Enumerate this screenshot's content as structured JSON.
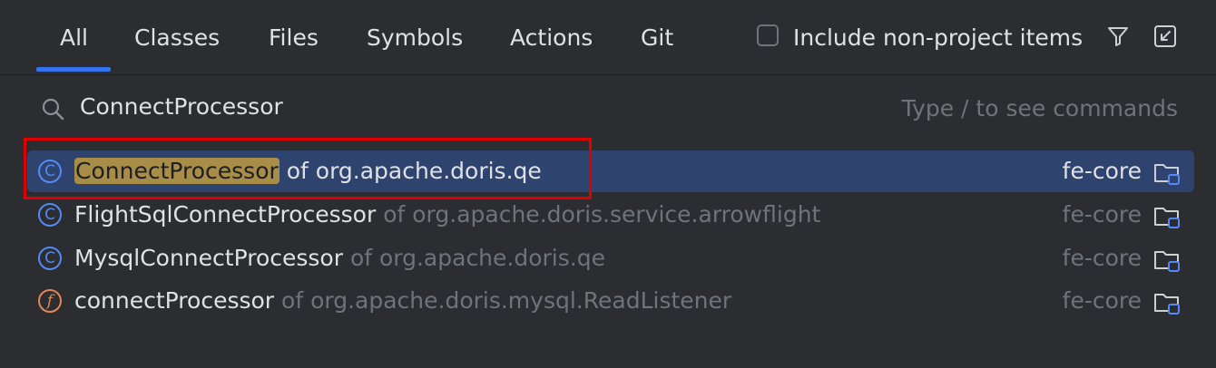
{
  "tabs": [
    {
      "label": "All",
      "active": true
    },
    {
      "label": "Classes"
    },
    {
      "label": "Files"
    },
    {
      "label": "Symbols"
    },
    {
      "label": "Actions"
    },
    {
      "label": "Git"
    }
  ],
  "options": {
    "include_non_project_label": "Include non-project items",
    "include_non_project_checked": false,
    "filter_icon": "filter-icon",
    "pin_icon": "open-in-window-icon"
  },
  "search": {
    "value": "ConnectProcessor",
    "hint": "Type / to see commands"
  },
  "results": [
    {
      "icon": "class-icon",
      "icon_letter": "C",
      "name": "ConnectProcessor",
      "qualifier": "of org.apache.doris.qe",
      "module": "fe-core",
      "selected": true
    },
    {
      "icon": "class-icon",
      "icon_letter": "C",
      "name": "FlightSqlConnectProcessor",
      "qualifier": "of org.apache.doris.service.arrowflight",
      "module": "fe-core"
    },
    {
      "icon": "class-icon",
      "icon_letter": "C",
      "name": "MysqlConnectProcessor",
      "qualifier": "of org.apache.doris.qe",
      "module": "fe-core"
    },
    {
      "icon": "field-icon",
      "icon_letter": "f",
      "name": "connectProcessor",
      "qualifier": "of org.apache.doris.mysql.ReadListener",
      "module": "fe-core"
    }
  ],
  "colors": {
    "background": "#2b2d30",
    "accent": "#3574f0",
    "selection": "#2e436e",
    "match_highlight": "#a88d48",
    "annotation": "#e00000"
  }
}
